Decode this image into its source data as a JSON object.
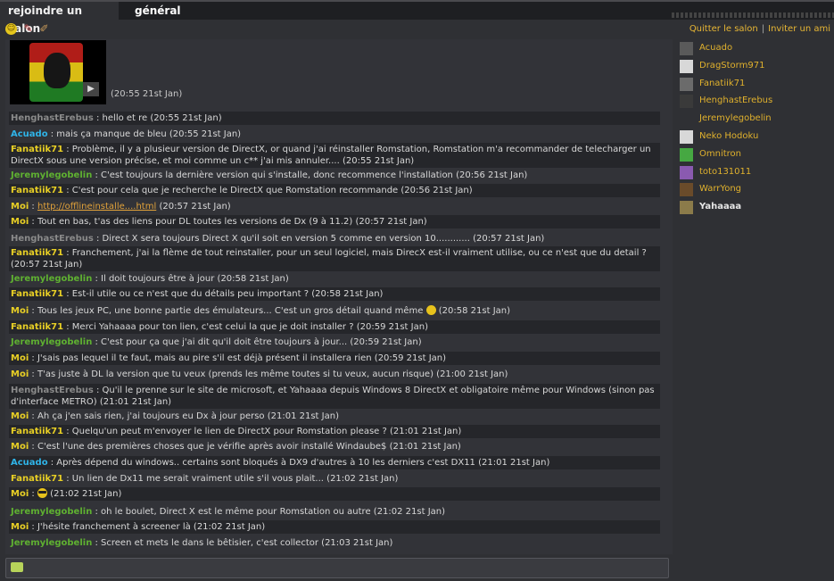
{
  "tabs": [
    {
      "label": "rejoindre un salon"
    },
    {
      "label": "général"
    }
  ],
  "toolbar": {
    "icons": [
      "smiley-icon",
      "pen-icon",
      "brush-icon"
    ]
  },
  "room_actions": {
    "quit": "Quitter le salon",
    "separator": "|",
    "invite": "Inviter un ami"
  },
  "media": {
    "time": "(20:55 21st Jan)",
    "play_glyph": "▶"
  },
  "messages": [
    {
      "nick": "HenghastErebus",
      "sep": " : ",
      "text": "hello et re",
      "time": " (20:55 21st Jan)"
    },
    {
      "nick": "Acuado",
      "sep": " : ",
      "text": "mais ça manque de bleu",
      "time": " (20:55 21st Jan)"
    },
    {
      "nick": "Fanatiik71",
      "sep": " : ",
      "text": "Problème, il y a plusieur version de DirectX, or quand j'ai réinstaller Romstation, Romstation m'a recommander de telecharger un DirectX sous une version précise, et moi comme un c** j'ai mis annuler....",
      "time": " (20:55 21st Jan)"
    },
    {
      "nick": "Jeremylegobelin",
      "sep": " : ",
      "text": "C'est toujours la dernière version qui s'installe, donc recommence l'installation",
      "time": " (20:56 21st Jan)"
    },
    {
      "nick": "Fanatiik71",
      "sep": " : ",
      "text": "C'est pour cela que je recherche le DirectX que Romstation recommande",
      "time": " (20:56 21st Jan)"
    },
    {
      "nick": "Moi",
      "sep": " : ",
      "link": "http://offlineinstalle....html",
      "time": " (20:57 21st Jan)"
    },
    {
      "nick": "Moi",
      "sep": " : ",
      "text": "Tout en bas, t'as des liens pour DL toutes les versions de Dx (9 à 11.2)",
      "time": " (20:57 21st Jan)"
    },
    {
      "nick": "HenghastErebus",
      "sep": " : ",
      "text": "Direct X sera toujours Direct X qu'il soit en version 5 comme en version 10............",
      "time": " (20:57 21st Jan)"
    },
    {
      "nick": "Fanatiik71",
      "sep": " : ",
      "text": "Franchement, j'ai la flème de tout reinstaller, pour un seul logiciel, mais DirecX est-il vraiment utilise, ou ce n'est que du detail ?",
      "time": " (20:57 21st Jan)"
    },
    {
      "nick": "Jeremylegobelin",
      "sep": " : ",
      "text": "Il doit toujours être à jour",
      "time": " (20:58 21st Jan)"
    },
    {
      "nick": "Fanatiik71",
      "sep": " : ",
      "text": "Est-il utile ou ce n'est que du détails peu important ?",
      "time": " (20:58 21st Jan)"
    },
    {
      "nick": "Moi",
      "sep": " : ",
      "text": "Tous les jeux PC, une bonne partie des émulateurs... C'est un gros détail quand même",
      "time": " (20:58 21st Jan)"
    },
    {
      "nick": "Fanatiik71",
      "sep": " : ",
      "text": "Merci Yahaaaa pour ton lien, c'est celui la que je doit installer ?",
      "time": " (20:59 21st Jan)"
    },
    {
      "nick": "Jeremylegobelin",
      "sep": " : ",
      "text": "C'est pour ça que j'ai dit qu'il doit être toujours à jour...",
      "time": " (20:59 21st Jan)"
    },
    {
      "nick": "Moi",
      "sep": " : ",
      "text": "J'sais pas lequel il te faut, mais au pire s'il est déjà présent il installera rien",
      "time": " (20:59 21st Jan)"
    },
    {
      "nick": "Moi",
      "sep": " : ",
      "text": "T'as juste à DL la version que tu veux (prends les même toutes si tu veux, aucun risque)",
      "time": " (21:00 21st Jan)"
    },
    {
      "nick": "HenghastErebus",
      "sep": " : ",
      "text": "Qu'il le prenne sur le site de microsoft, et Yahaaaa depuis Windows 8 DirectX et obligatoire même pour Windows (sinon pas d'interface METRO)",
      "time": " (21:01 21st Jan)"
    },
    {
      "nick": "Moi",
      "sep": " : ",
      "text": "Ah ça j'en sais rien, j'ai toujours eu Dx à jour perso",
      "time": " (21:01 21st Jan)"
    },
    {
      "nick": "Fanatiik71",
      "sep": " : ",
      "text": "Quelqu'un peut m'envoyer le lien de DirectX pour Romstation please ?",
      "time": " (21:01 21st Jan)"
    },
    {
      "nick": "Moi",
      "sep": " : ",
      "text": "C'est l'une des premières choses que je vérifie après avoir installé Windaube$",
      "time": " (21:01 21st Jan)"
    },
    {
      "nick": "Acuado",
      "sep": " : ",
      "text": "Après dépend du windows.. certains sont bloqués à DX9 d'autres à 10 les derniers c'est DX11",
      "time": " (21:01 21st Jan)"
    },
    {
      "nick": "Fanatiik71",
      "sep": " : ",
      "text": "Un lien de Dx11 me serait vraiment utile s'il vous plait...",
      "time": " (21:02 21st Jan)"
    },
    {
      "nick": "Moi",
      "sep": " : ",
      "text": "",
      "time": " (21:02 21st Jan)"
    },
    {
      "nick": "Jeremylegobelin",
      "sep": " : ",
      "text": "oh le boulet, Direct X est le même pour Romstation ou autre",
      "time": " (21:02 21st Jan)"
    },
    {
      "nick": "Moi",
      "sep": " : ",
      "text": "J'hésite franchement à screener là",
      "time": " (21:02 21st Jan)"
    },
    {
      "nick": "Jeremylegobelin",
      "sep": " : ",
      "text": "Screen et mets le dans le bêtisier, c'est collector",
      "time": " (21:03 21st Jan)"
    }
  ],
  "input": {
    "value": ""
  },
  "users": [
    {
      "name": "Acuado",
      "avatar_color": "#5a5a5a"
    },
    {
      "name": "DragStorm971",
      "avatar_color": "#d8d8d8"
    },
    {
      "name": "Fanatiik71",
      "avatar_color": "#6b6b6b"
    },
    {
      "name": "HenghastErebus",
      "avatar_color": "#3a3a3a"
    },
    {
      "name": "Jeremylegobelin",
      "avatar_color": "#2f3034"
    },
    {
      "name": "Neko Hodoku",
      "avatar_color": "#d8d8d8"
    },
    {
      "name": "Omnitron",
      "avatar_color": "#46a842"
    },
    {
      "name": "toto131011",
      "avatar_color": "#8a5ab0"
    },
    {
      "name": "WarrYong",
      "avatar_color": "#6a4b2a"
    },
    {
      "name": "Yahaaaa",
      "avatar_color": "#8b7b4a"
    }
  ],
  "colors": {
    "nick_grey": "#8a8a8a",
    "nick_cyan": "#2fb4e8",
    "nick_yellow": "#e8cf25",
    "nick_green": "#5fb131",
    "nick_orange": "#e1a23a",
    "user_link": "#e0b12d"
  }
}
